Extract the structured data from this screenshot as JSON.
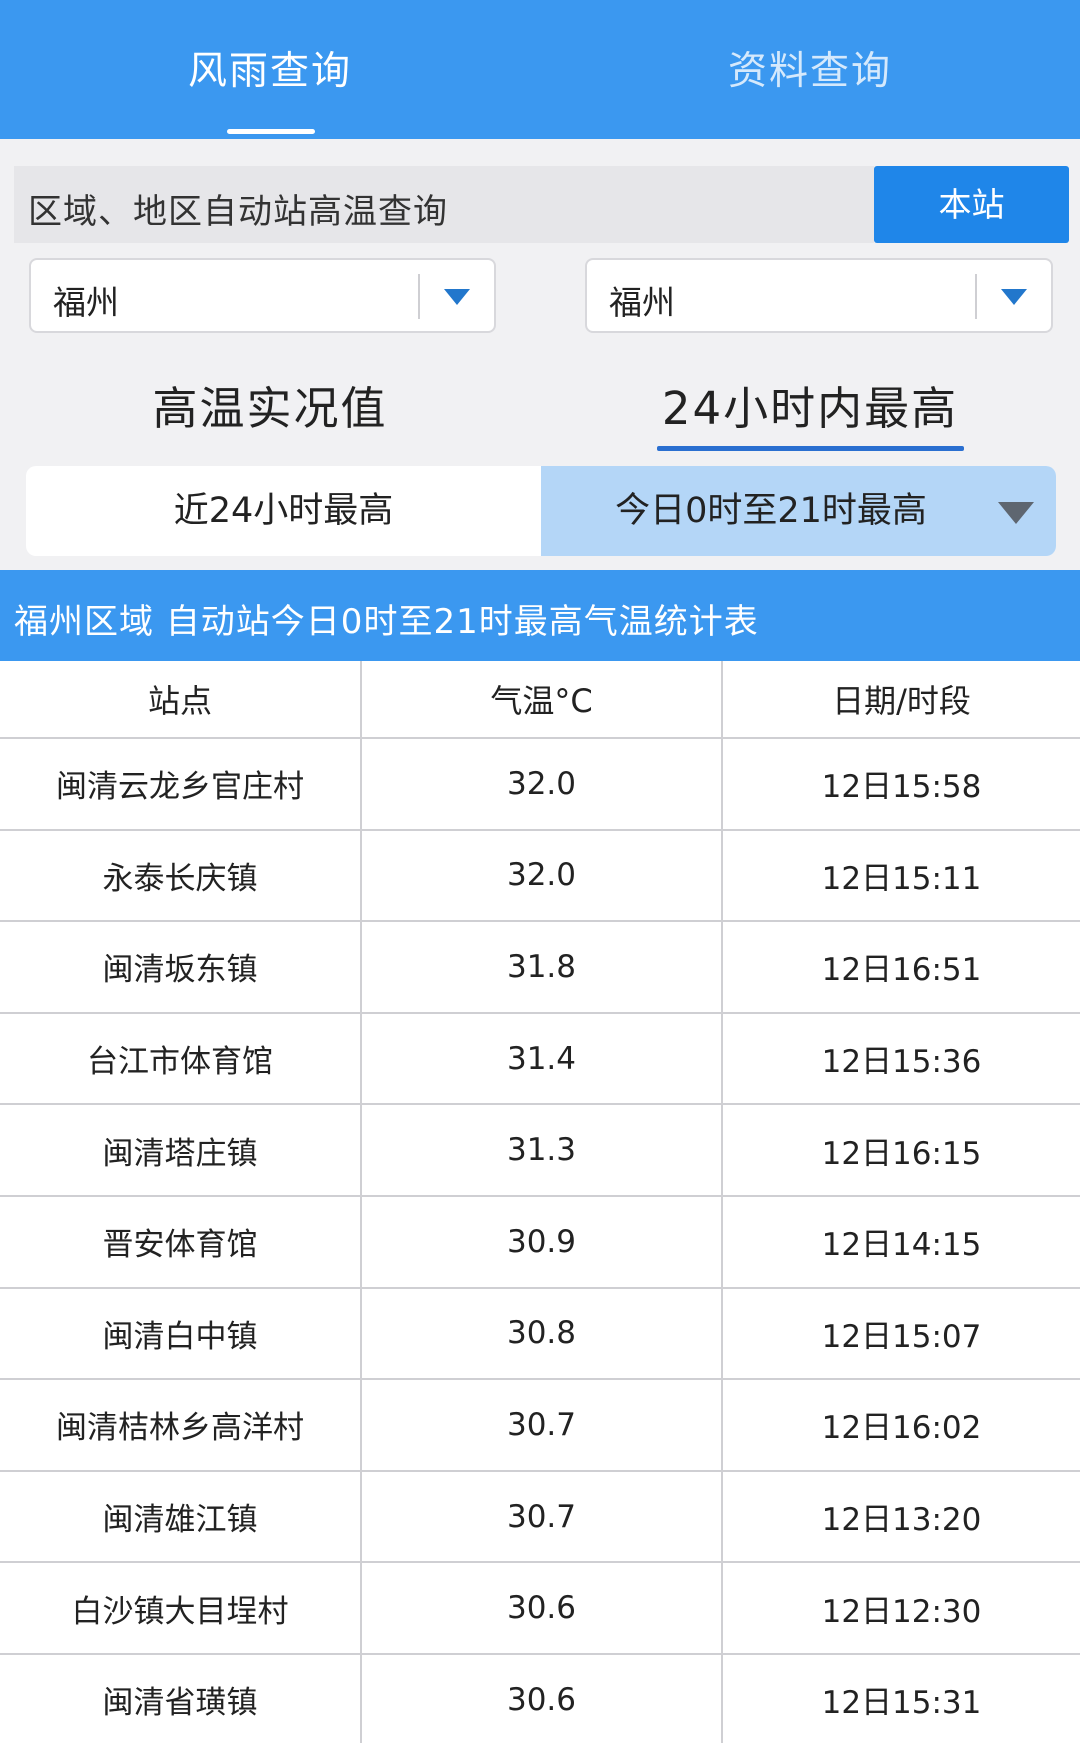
{
  "top_tabs": [
    {
      "label": "风雨查询",
      "active": true
    },
    {
      "label": "资料查询",
      "active": false
    }
  ],
  "query": {
    "label": "区域、地区自动站高温查询",
    "station_button": "本站"
  },
  "selects": [
    {
      "value": "福州"
    },
    {
      "value": "福州"
    }
  ],
  "modes": [
    {
      "label": "高温实况值",
      "active": false
    },
    {
      "label": "24小时内最高",
      "active": true
    }
  ],
  "segments": {
    "option1": "近24小时最高",
    "option2": "今日0时至21时最高"
  },
  "table_title": "福州区域 自动站今日0时至21时最高气温统计表",
  "table": {
    "headers": [
      "站点",
      "气温°C",
      "日期/时段"
    ],
    "rows": [
      [
        "闽清云龙乡官庄村",
        "32.0",
        "12日15:58"
      ],
      [
        "永泰长庆镇",
        "32.0",
        "12日15:11"
      ],
      [
        "闽清坂东镇",
        "31.8",
        "12日16:51"
      ],
      [
        "台江市体育馆",
        "31.4",
        "12日15:36"
      ],
      [
        "闽清塔庄镇",
        "31.3",
        "12日16:15"
      ],
      [
        "晋安体育馆",
        "30.9",
        "12日14:15"
      ],
      [
        "闽清白中镇",
        "30.8",
        "12日15:07"
      ],
      [
        "闽清桔林乡高洋村",
        "30.7",
        "12日16:02"
      ],
      [
        "闽清雄江镇",
        "30.7",
        "12日13:20"
      ],
      [
        "白沙镇大目埕村",
        "30.6",
        "12日12:30"
      ],
      [
        "闽清省璜镇",
        "30.6",
        "12日15:31"
      ]
    ]
  },
  "colors": {
    "primary": "#3b98f0",
    "button": "#1f86e9",
    "segment_active": "#b4d6f7",
    "underline": "#2a6fd0"
  },
  "icons": [
    "dropdown-arrow-icon",
    "dropdown-caret-icon"
  ]
}
